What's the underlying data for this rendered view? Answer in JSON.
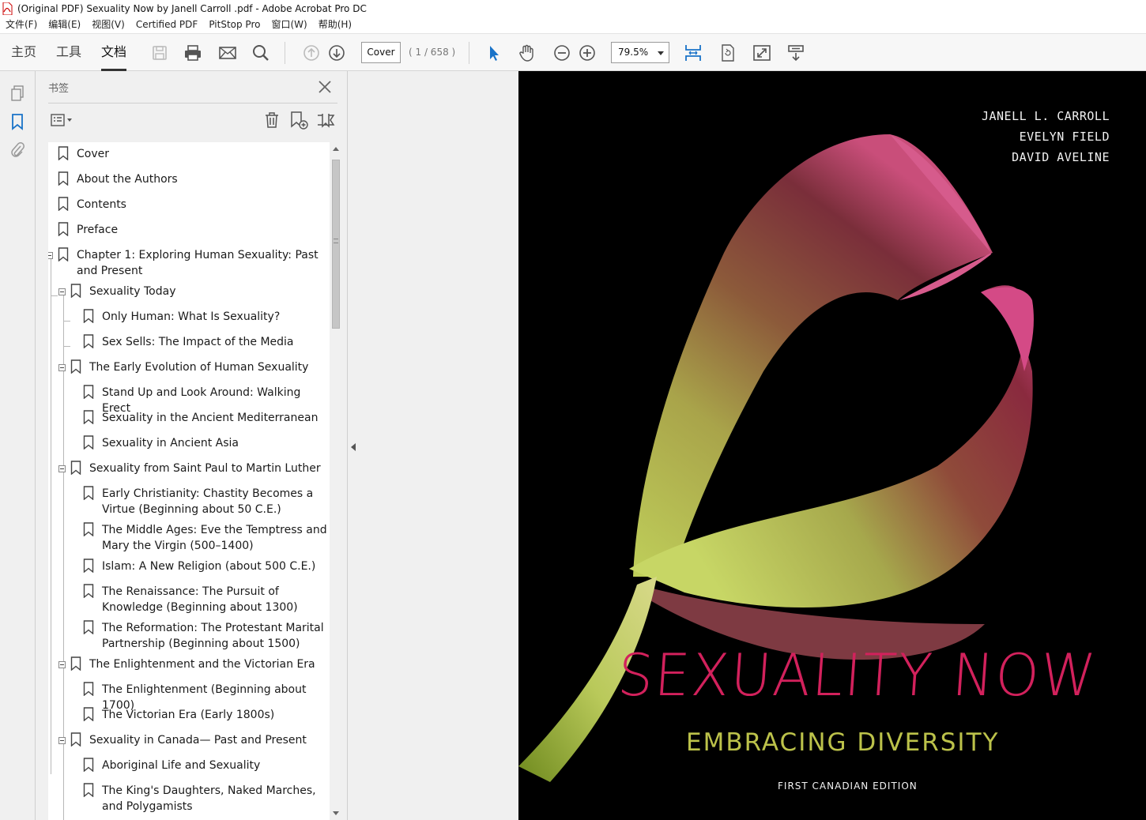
{
  "window": {
    "title": "(Original PDF) Sexuality Now by Janell Carroll .pdf - Adobe Acrobat Pro DC"
  },
  "menu": [
    "文件(F)",
    "编辑(E)",
    "视图(V)",
    "Certified PDF",
    "PitStop Pro",
    "窗口(W)",
    "帮助(H)"
  ],
  "toolbar": {
    "tabs": [
      "主页",
      "工具",
      "文档"
    ],
    "page_field": "Cover",
    "page_count": "( 1 / 658 )",
    "zoom": "79.5%"
  },
  "bookmarks": {
    "title": "书签",
    "items": [
      {
        "label": "Cover",
        "level": 0,
        "expander": false
      },
      {
        "label": "About the Authors",
        "level": 0,
        "expander": false
      },
      {
        "label": "Contents",
        "level": 0,
        "expander": false
      },
      {
        "label": "Preface",
        "level": 0,
        "expander": false
      },
      {
        "label": "Chapter 1: Exploring Human Sexuality: Past and Present",
        "level": 0,
        "expander": true
      },
      {
        "label": "Sexuality Today",
        "level": 1,
        "expander": true
      },
      {
        "label": "Only Human: What Is Sexuality?",
        "level": 2,
        "expander": false
      },
      {
        "label": "Sex Sells: The Impact of the Media",
        "level": 2,
        "expander": false
      },
      {
        "label": "The Early Evolution of Human Sexuality",
        "level": 1,
        "expander": true
      },
      {
        "label": "Stand Up and Look Around: Walking Erect",
        "level": 2,
        "expander": false
      },
      {
        "label": "Sexuality in the Ancient Mediterranean",
        "level": 2,
        "expander": false
      },
      {
        "label": "Sexuality in Ancient Asia",
        "level": 2,
        "expander": false
      },
      {
        "label": "Sexuality from Saint Paul to Martin Luther",
        "level": 1,
        "expander": true
      },
      {
        "label": "Early Christianity: Chastity Becomes a Virtue (Beginning about 50 C.E.)",
        "level": 2,
        "expander": false
      },
      {
        "label": "The Middle Ages: Eve the Temptress and Mary the Virgin (500–1400)",
        "level": 2,
        "expander": false
      },
      {
        "label": "Islam: A New Religion (about 500 C.E.)",
        "level": 2,
        "expander": false
      },
      {
        "label": "The Renaissance: The Pursuit of Knowledge (Beginning about 1300)",
        "level": 2,
        "expander": false
      },
      {
        "label": "The Reformation: The Protestant Marital Partnership (Beginning about 1500)",
        "level": 2,
        "expander": false
      },
      {
        "label": "The Enlightenment and the Victorian Era",
        "level": 1,
        "expander": true
      },
      {
        "label": "The Enlightenment (Beginning about 1700)",
        "level": 2,
        "expander": false
      },
      {
        "label": "The Victorian Era (Early 1800s)",
        "level": 2,
        "expander": false
      },
      {
        "label": "Sexuality in Canada— Past and Present",
        "level": 1,
        "expander": true
      },
      {
        "label": "Aboriginal Life and Sexuality",
        "level": 2,
        "expander": false
      },
      {
        "label": "The King's Daughters, Naked Marches, and Polygamists",
        "level": 2,
        "expander": false
      }
    ]
  },
  "cover": {
    "authors": [
      "JANELL L. CARROLL",
      "EVELYN FIELD",
      "DAVID AVELINE"
    ],
    "title": "SEXUALITY NOW",
    "subtitle": "EMBRACING DIVERSITY",
    "edition": "FIRST CANADIAN EDITION"
  },
  "colors": {
    "title_pink": "#d2215c",
    "subtitle_green": "#bcc24a",
    "active_tool_blue": "#1a73c8"
  }
}
